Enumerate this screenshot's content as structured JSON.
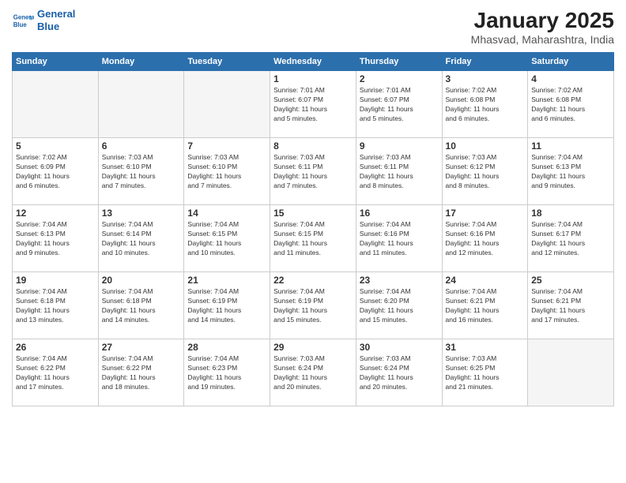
{
  "header": {
    "logo_line1": "General",
    "logo_line2": "Blue",
    "title": "January 2025",
    "subtitle": "Mhasvad, Maharashtra, India"
  },
  "weekdays": [
    "Sunday",
    "Monday",
    "Tuesday",
    "Wednesday",
    "Thursday",
    "Friday",
    "Saturday"
  ],
  "weeks": [
    [
      {
        "num": "",
        "info": ""
      },
      {
        "num": "",
        "info": ""
      },
      {
        "num": "",
        "info": ""
      },
      {
        "num": "1",
        "info": "Sunrise: 7:01 AM\nSunset: 6:07 PM\nDaylight: 11 hours\nand 5 minutes."
      },
      {
        "num": "2",
        "info": "Sunrise: 7:01 AM\nSunset: 6:07 PM\nDaylight: 11 hours\nand 5 minutes."
      },
      {
        "num": "3",
        "info": "Sunrise: 7:02 AM\nSunset: 6:08 PM\nDaylight: 11 hours\nand 6 minutes."
      },
      {
        "num": "4",
        "info": "Sunrise: 7:02 AM\nSunset: 6:08 PM\nDaylight: 11 hours\nand 6 minutes."
      }
    ],
    [
      {
        "num": "5",
        "info": "Sunrise: 7:02 AM\nSunset: 6:09 PM\nDaylight: 11 hours\nand 6 minutes."
      },
      {
        "num": "6",
        "info": "Sunrise: 7:03 AM\nSunset: 6:10 PM\nDaylight: 11 hours\nand 7 minutes."
      },
      {
        "num": "7",
        "info": "Sunrise: 7:03 AM\nSunset: 6:10 PM\nDaylight: 11 hours\nand 7 minutes."
      },
      {
        "num": "8",
        "info": "Sunrise: 7:03 AM\nSunset: 6:11 PM\nDaylight: 11 hours\nand 7 minutes."
      },
      {
        "num": "9",
        "info": "Sunrise: 7:03 AM\nSunset: 6:11 PM\nDaylight: 11 hours\nand 8 minutes."
      },
      {
        "num": "10",
        "info": "Sunrise: 7:03 AM\nSunset: 6:12 PM\nDaylight: 11 hours\nand 8 minutes."
      },
      {
        "num": "11",
        "info": "Sunrise: 7:04 AM\nSunset: 6:13 PM\nDaylight: 11 hours\nand 9 minutes."
      }
    ],
    [
      {
        "num": "12",
        "info": "Sunrise: 7:04 AM\nSunset: 6:13 PM\nDaylight: 11 hours\nand 9 minutes."
      },
      {
        "num": "13",
        "info": "Sunrise: 7:04 AM\nSunset: 6:14 PM\nDaylight: 11 hours\nand 10 minutes."
      },
      {
        "num": "14",
        "info": "Sunrise: 7:04 AM\nSunset: 6:15 PM\nDaylight: 11 hours\nand 10 minutes."
      },
      {
        "num": "15",
        "info": "Sunrise: 7:04 AM\nSunset: 6:15 PM\nDaylight: 11 hours\nand 11 minutes."
      },
      {
        "num": "16",
        "info": "Sunrise: 7:04 AM\nSunset: 6:16 PM\nDaylight: 11 hours\nand 11 minutes."
      },
      {
        "num": "17",
        "info": "Sunrise: 7:04 AM\nSunset: 6:16 PM\nDaylight: 11 hours\nand 12 minutes."
      },
      {
        "num": "18",
        "info": "Sunrise: 7:04 AM\nSunset: 6:17 PM\nDaylight: 11 hours\nand 12 minutes."
      }
    ],
    [
      {
        "num": "19",
        "info": "Sunrise: 7:04 AM\nSunset: 6:18 PM\nDaylight: 11 hours\nand 13 minutes."
      },
      {
        "num": "20",
        "info": "Sunrise: 7:04 AM\nSunset: 6:18 PM\nDaylight: 11 hours\nand 14 minutes."
      },
      {
        "num": "21",
        "info": "Sunrise: 7:04 AM\nSunset: 6:19 PM\nDaylight: 11 hours\nand 14 minutes."
      },
      {
        "num": "22",
        "info": "Sunrise: 7:04 AM\nSunset: 6:19 PM\nDaylight: 11 hours\nand 15 minutes."
      },
      {
        "num": "23",
        "info": "Sunrise: 7:04 AM\nSunset: 6:20 PM\nDaylight: 11 hours\nand 15 minutes."
      },
      {
        "num": "24",
        "info": "Sunrise: 7:04 AM\nSunset: 6:21 PM\nDaylight: 11 hours\nand 16 minutes."
      },
      {
        "num": "25",
        "info": "Sunrise: 7:04 AM\nSunset: 6:21 PM\nDaylight: 11 hours\nand 17 minutes."
      }
    ],
    [
      {
        "num": "26",
        "info": "Sunrise: 7:04 AM\nSunset: 6:22 PM\nDaylight: 11 hours\nand 17 minutes."
      },
      {
        "num": "27",
        "info": "Sunrise: 7:04 AM\nSunset: 6:22 PM\nDaylight: 11 hours\nand 18 minutes."
      },
      {
        "num": "28",
        "info": "Sunrise: 7:04 AM\nSunset: 6:23 PM\nDaylight: 11 hours\nand 19 minutes."
      },
      {
        "num": "29",
        "info": "Sunrise: 7:03 AM\nSunset: 6:24 PM\nDaylight: 11 hours\nand 20 minutes."
      },
      {
        "num": "30",
        "info": "Sunrise: 7:03 AM\nSunset: 6:24 PM\nDaylight: 11 hours\nand 20 minutes."
      },
      {
        "num": "31",
        "info": "Sunrise: 7:03 AM\nSunset: 6:25 PM\nDaylight: 11 hours\nand 21 minutes."
      },
      {
        "num": "",
        "info": ""
      }
    ]
  ]
}
